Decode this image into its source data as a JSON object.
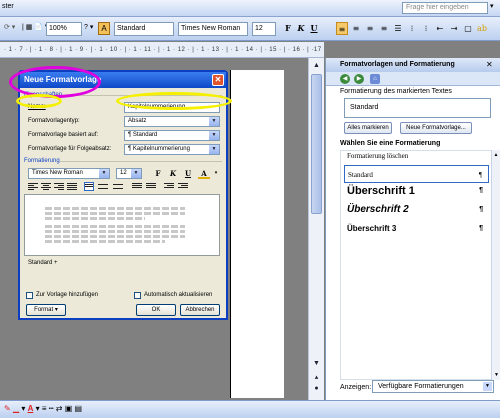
{
  "menubar": {
    "partial_item": "ster",
    "help_placeholder": "Frage hier eingeben"
  },
  "toolbar": {
    "zoom": "100%",
    "style": "Standard",
    "font": "Times New Roman",
    "size": "12"
  },
  "ruler": {
    "ticks": "· 1 · 7 · | · 1 · 8 · | · 1 · 9 · | · 1 · 10 · | · 1 · 11 · | · 1 · 12 · | · 1 · 13 · | · 1 · 14 · | · 15 · | · 16 · | ·17 · | · 18"
  },
  "taskpane": {
    "title": "Formatvorlagen und Formatierung",
    "selected_label": "Formatierung des markierten Textes",
    "selected_value": "Standard",
    "select_all_button": "Alles markieren",
    "new_style_button": "Neue Formatvorlage...",
    "choose_label": "Wählen Sie eine Formatierung",
    "styles": [
      "Formatierung löschen",
      "Standard",
      "Überschrift 1",
      "Überschrift 2",
      "Überschrift 3"
    ],
    "pilcrow": "¶",
    "show_label": "Anzeigen:",
    "show_value": "Verfügbare Formatierungen"
  },
  "dialog": {
    "title": "Neue Formatvorlage",
    "close": "✕",
    "section_properties": "Eigenschaften",
    "name_label": "Name:",
    "name_value": "Kapitelnummerierung",
    "type_label": "Formatvorlagentyp:",
    "type_value": "Absatz",
    "based_label": "Formatvorlage basiert auf:",
    "based_value": "¶ Standard",
    "next_label": "Formatvorlage für Folgeabsatz:",
    "next_value": "¶ Kapitelnummerierung",
    "section_format": "Formatierung",
    "font_value": "Times New Roman",
    "size_value": "12",
    "bold": "F",
    "italic": "K",
    "underline": "U",
    "fontcolor": "A",
    "description": "Standard +",
    "add_to_template": "Zur Vorlage hinzufügen",
    "auto_update": "Automatisch aktualisieren",
    "format_button": "Format ▾",
    "ok_button": "OK",
    "cancel_button": "Abbrechen"
  },
  "colors": {
    "annotation_magenta": "#e000e0",
    "annotation_yellow": "#f5f000",
    "titlebar_blue": "#0e49c8"
  }
}
